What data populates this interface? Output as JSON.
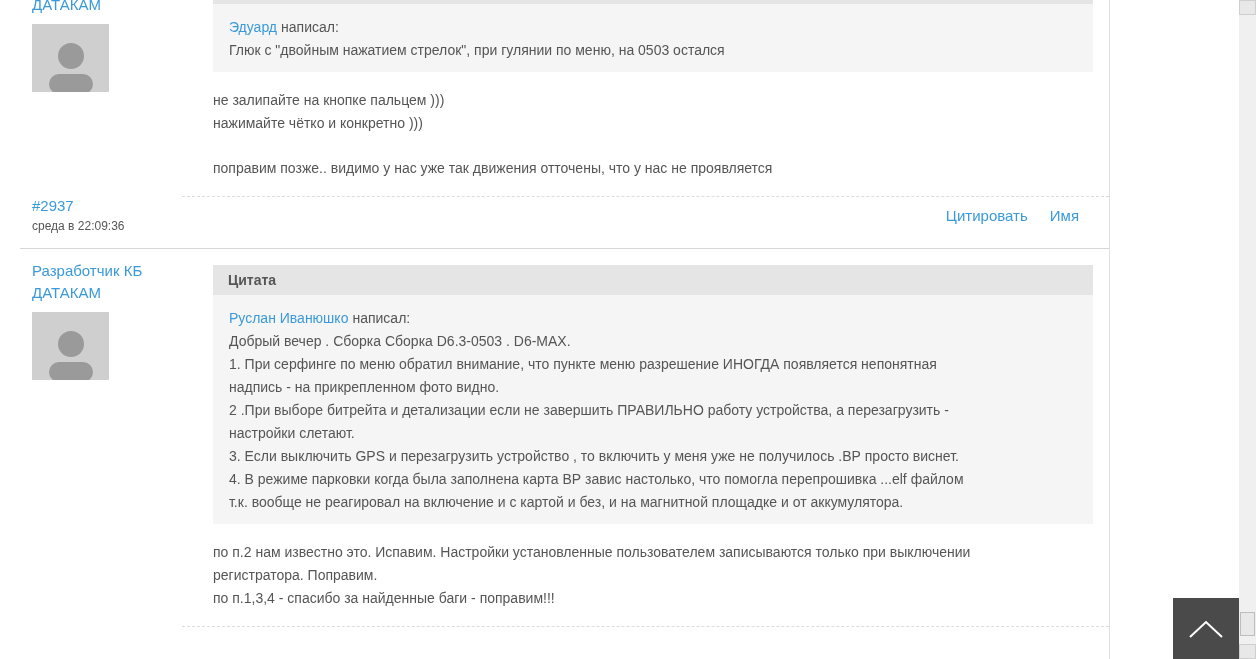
{
  "posts": [
    {
      "author": "ДАТАКАМ",
      "quote": {
        "author": "Эдуард",
        "verb": "написал:",
        "lines": [
          "Глюк с \"двойным нажатием стрелок\", при гулянии по меню, на 0503 остался"
        ]
      },
      "body": [
        [
          "не залипайте на кнопке пальцем )))",
          "нажимайте чётко и конкретно )))"
        ],
        [
          "поправим позже.. видимо у нас уже так движения отточены, что у нас не проявляется"
        ]
      ],
      "footer": {
        "number": "#2937",
        "date": "среда в 22:09:36",
        "actions": [
          "Цитировать",
          "Имя"
        ]
      }
    },
    {
      "author": "Разработчик КБ ДАТАКАМ",
      "quote": {
        "title": "Цитата",
        "author": "Руслан Иванюшко",
        "verb": "написал:",
        "lines": [
          "Добрый вечер . Сборка Сборка D6.3-0503 . D6-MAX.",
          "1. При серфинге по меню обратил внимание, что пункте меню разрешение ИНОГДА появляется непонятная",
          "надпись - на прикрепленном фото видно.",
          "2 .При выборе битрейта и детализации если не завершить ПРАВИЛЬНО работу устройства, а перезагрузить -",
          "настройки слетают.",
          "3. Если выключить GPS и перезагрузить устройство , то включить у меня уже не получилось .ВР просто виснет.",
          "4. В режиме парковки когда была заполнена карта ВР завис настолько, что помогла перепрошивка ...elf файлом",
          "т.к. вообще не реагировал на включение и с картой и без, и на магнитной площадке и от аккумулятора."
        ]
      },
      "body": [
        [
          "по п.2 нам известно это. Испавим. Настройки установленные пользователем записываются только при выключении",
          "регистратора. Поправим.",
          "по п.1,3,4 - спасибо за найденные баги - поправим!!!"
        ]
      ]
    }
  ]
}
